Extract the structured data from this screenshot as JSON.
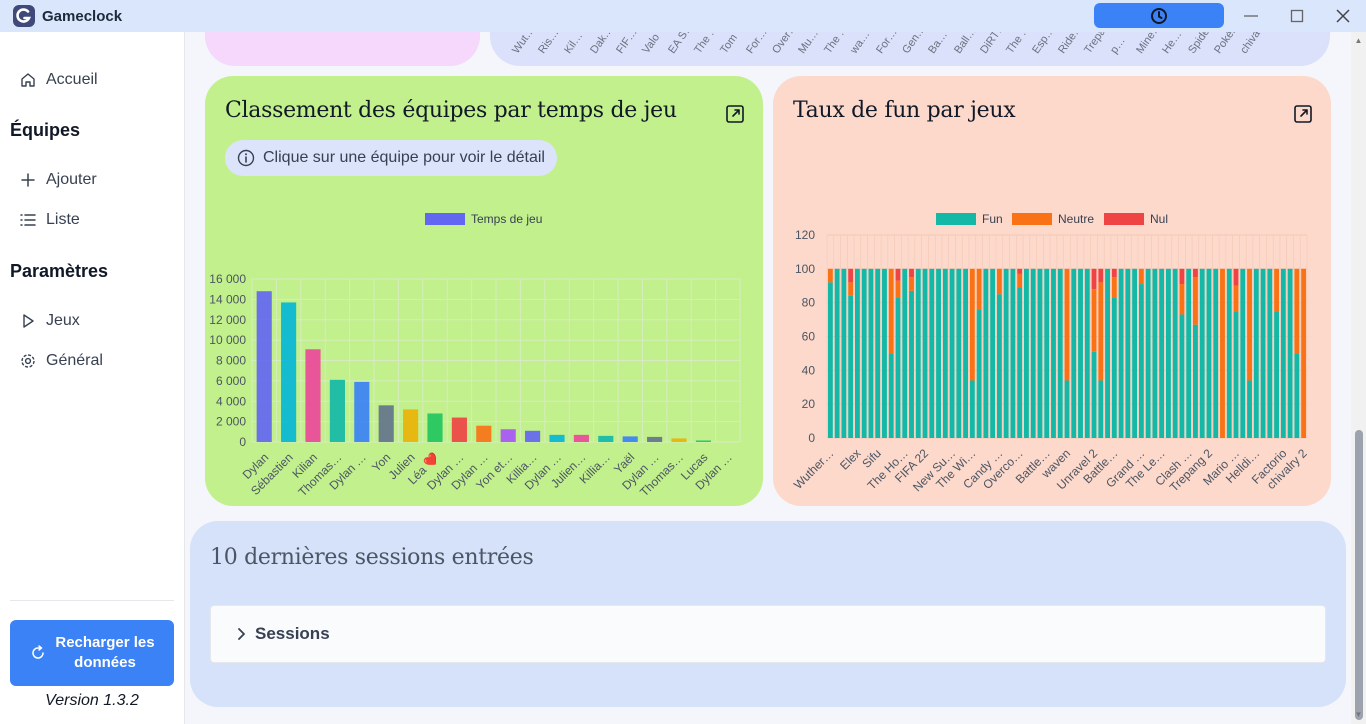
{
  "window": {
    "title": "Gameclock"
  },
  "colors": {
    "accent": "#3b82f6",
    "green_card": "#c2f08c",
    "salmon_card": "#fdd9cb",
    "fun": "#14b8a6",
    "neutre": "#f97316",
    "nul": "#ef4444"
  },
  "sidebar": {
    "home": "Accueil",
    "teams_section": "Équipes",
    "add": "Ajouter",
    "list": "Liste",
    "settings_section": "Paramètres",
    "games": "Jeux",
    "general": "Général",
    "reload": "Recharger les données",
    "version": "Version 1.3.2"
  },
  "top_chart_labels": [
    "Wut…",
    "Ris…",
    "Kil…",
    "Dak…",
    "FIF…",
    "Valo",
    "EA S…",
    "The …",
    "Tom",
    "For…",
    "Over…",
    "Mu…",
    "The …",
    "wa…",
    "For…",
    "Gen…",
    "Ba…",
    "Ball…",
    "DiRT…",
    "The …",
    "Esp…",
    "Ride…",
    "Trepa…",
    "p…",
    "Mine…",
    "He…",
    "Spider…",
    "PokéRo…",
    "chiva…"
  ],
  "teams_card": {
    "title": "Classement des équipes par temps de jeu",
    "hint": "Clique sur une équipe pour voir le détail"
  },
  "fun_card": {
    "title": "Taux de fun par jeux"
  },
  "chart_data": [
    {
      "type": "bar",
      "title": "Classement des équipes par temps de jeu",
      "series": [
        {
          "name": "Temps de jeu",
          "values": [
            14800,
            13700,
            9100,
            6100,
            5900,
            3600,
            3200,
            2800,
            2400,
            1600,
            1250,
            1100,
            700,
            700,
            600,
            550,
            500,
            350,
            150,
            0
          ]
        }
      ],
      "categories": [
        "Dylan",
        "Sébastien",
        "Kilian",
        "Thomas…",
        "Dylan …",
        "Yon",
        "Julien",
        "Léa ❤️",
        "Dylan …",
        "Dylan …",
        "Yon et…",
        "Killia…",
        "Dylan …",
        "Julien…",
        "Killia…",
        "Yaël",
        "Dylan …",
        "Thomas…",
        "Lucas",
        "Dylan …"
      ],
      "tick_labels": [
        "0",
        "2 000",
        "4 000",
        "6 000",
        "8 000",
        "10 000",
        "12 000",
        "14 000",
        "16 000"
      ],
      "colors": [
        "#6366f1",
        "#06b6d4",
        "#ec4899",
        "#14b8a6",
        "#3b82f6",
        "#64748b",
        "#eab308",
        "#22c55e",
        "#ef4444",
        "#f97316",
        "#a855f7",
        "#6366f1",
        "#06b6d4",
        "#ec4899",
        "#14b8a6",
        "#3b82f6",
        "#64748b",
        "#eab308",
        "#22c55e",
        "#ef4444"
      ],
      "ylim": [
        0,
        16000
      ],
      "legend": "top",
      "grid": true
    },
    {
      "type": "bar",
      "stacked": true,
      "title": "Taux de fun par jeux",
      "ylim": [
        0,
        120
      ],
      "tick_labels": [
        "0",
        "20",
        "40",
        "60",
        "80",
        "100",
        "120"
      ],
      "legend": "top",
      "grid": true,
      "visible_categories": [
        "Wuther…",
        "Elex",
        "Sifu",
        "The Ho…",
        "FIFA 22",
        "New Su…",
        "The Wi…",
        "Candy …",
        "Overco…",
        "Battle…",
        "waven",
        "Unravel 2",
        "Battle…",
        "Grand …",
        "The Le…",
        "Clash …",
        "Trepang 2",
        "Mario …",
        "Helldi…",
        "Factorio",
        "chivalry 2"
      ],
      "series": [
        {
          "name": "Fun",
          "values": [
            92,
            100,
            100,
            84,
            100,
            100,
            100,
            100,
            100,
            50,
            83,
            100,
            87,
            100,
            100,
            100,
            100,
            100,
            100,
            100,
            100,
            34,
            76,
            100,
            100,
            85,
            100,
            100,
            89,
            100,
            100,
            100,
            100,
            100,
            100,
            34,
            100,
            100,
            100,
            51,
            34,
            100,
            83,
            100,
            100,
            100,
            91,
            100,
            100,
            100,
            100,
            100,
            73,
            100,
            67,
            100,
            100,
            100,
            0,
            100,
            75,
            100,
            34,
            100,
            100,
            100,
            75,
            100,
            100,
            50,
            0
          ]
        },
        {
          "name": "Neutre",
          "values": [
            8,
            0,
            0,
            8,
            0,
            0,
            0,
            0,
            0,
            50,
            10,
            0,
            8,
            0,
            0,
            0,
            0,
            0,
            0,
            0,
            0,
            66,
            24,
            0,
            0,
            15,
            0,
            0,
            8,
            0,
            0,
            0,
            0,
            0,
            0,
            66,
            0,
            0,
            0,
            37,
            58,
            0,
            12,
            0,
            0,
            0,
            9,
            0,
            0,
            0,
            0,
            0,
            18,
            0,
            28,
            0,
            0,
            0,
            100,
            0,
            15,
            0,
            66,
            0,
            0,
            0,
            25,
            0,
            0,
            50,
            100
          ]
        },
        {
          "name": "Nul",
          "values": [
            0,
            0,
            0,
            8,
            0,
            0,
            0,
            0,
            0,
            0,
            7,
            0,
            5,
            0,
            0,
            0,
            0,
            0,
            0,
            0,
            0,
            0,
            0,
            0,
            0,
            0,
            0,
            0,
            3,
            0,
            0,
            0,
            0,
            0,
            0,
            0,
            0,
            0,
            0,
            12,
            8,
            0,
            5,
            0,
            0,
            0,
            0,
            0,
            0,
            0,
            0,
            0,
            9,
            0,
            5,
            0,
            0,
            0,
            0,
            0,
            10,
            0,
            0,
            0,
            0,
            0,
            0,
            0,
            0,
            0,
            0
          ]
        }
      ]
    }
  ],
  "sessions": {
    "title": "10 dernières sessions entrées",
    "accordion_label": "Sessions"
  }
}
